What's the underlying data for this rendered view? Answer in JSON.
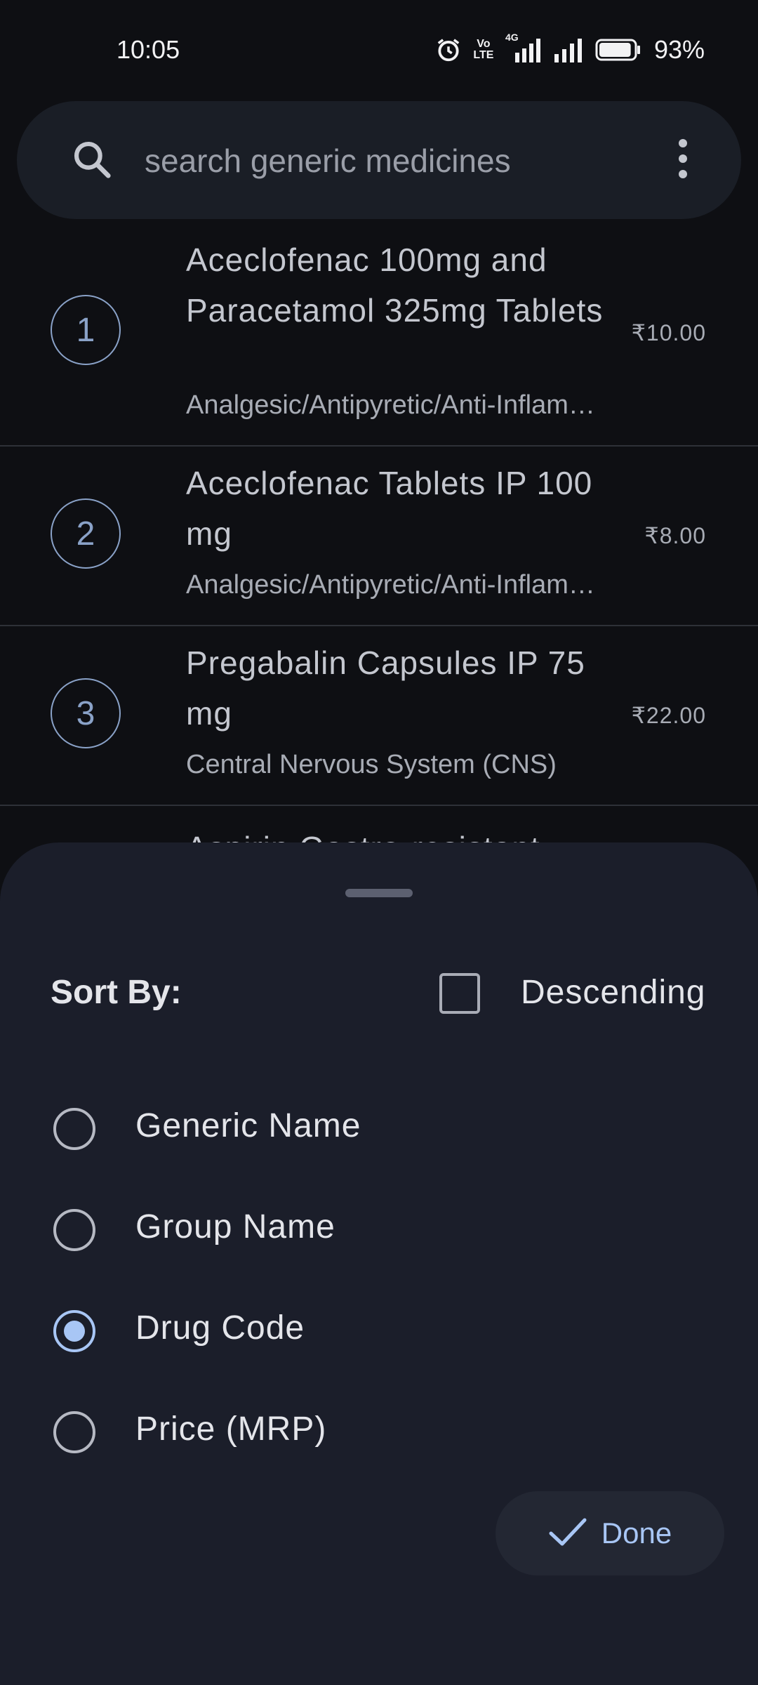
{
  "status_bar": {
    "time": "10:05",
    "volte": "Vo LTE",
    "network": "4G",
    "battery_percent": "93%",
    "battery_level": 0.93
  },
  "search": {
    "placeholder": "search generic medicines",
    "value": ""
  },
  "list": {
    "items": [
      {
        "number": "1",
        "title": "Aceclofenac 100mg and Paracetamol 325mg Tablets",
        "group": "Analgesic/Antipyretic/Anti-Inflammatory",
        "price": "₹10.00"
      },
      {
        "number": "2",
        "title": "Aceclofenac Tablets IP 100 mg",
        "group": "Analgesic/Antipyretic/Anti-Inflammatory",
        "price": "₹8.00"
      },
      {
        "number": "3",
        "title": "Pregabalin Capsules IP 75 mg",
        "group": "Central Nervous System (CNS)",
        "price": "₹22.00"
      },
      {
        "partial_title": "Aspirin Gastro-resistant"
      }
    ]
  },
  "sort_sheet": {
    "title": "Sort By:",
    "descending_label": "Descending",
    "descending_checked": false,
    "options": [
      {
        "label": "Generic Name",
        "selected": false
      },
      {
        "label": "Group Name",
        "selected": false
      },
      {
        "label": "Drug Code",
        "selected": true
      },
      {
        "label": "Price (MRP)",
        "selected": false
      }
    ],
    "done_label": "Done"
  },
  "colors": {
    "background": "#0e0f13",
    "sheet": "#1b1e2a",
    "accent": "#a8c6f5",
    "number_circle": "#8aa2c8"
  }
}
